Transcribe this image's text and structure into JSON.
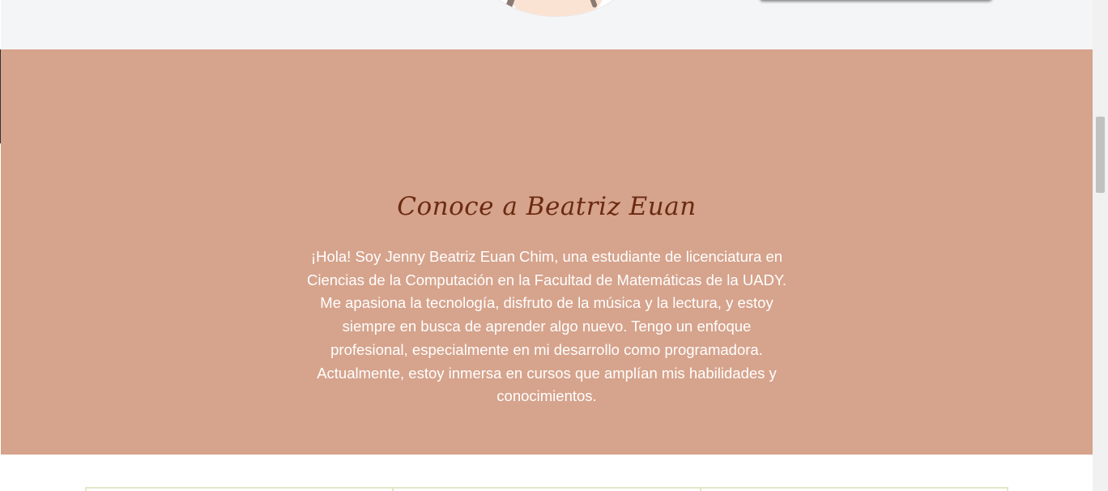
{
  "about": {
    "title": "Conoce a Beatriz Euan",
    "paragraph": "¡Hola! Soy Jenny Beatriz Euan Chim, una estudiante de licenciatura en Ciencias de la Computación en la Facultad de Matemáticas de la UADY. Me apasiona la tecnología, disfruto de la música y la lectura, y estoy siempre en busca de aprender algo nuevo. Tengo un enfoque profesional, especialmente en mi desarrollo como programadora. Actualmente, estoy inmersa en cursos que amplían mis habilidades y conocimientos."
  },
  "colors": {
    "section_background": "#d6a38c",
    "title": "#6b2a10",
    "text": "#ffffff",
    "top_band": "#f4f5f7",
    "card_border": "#dfe8c7"
  },
  "icons": {
    "avatar": "profile-illustration"
  }
}
